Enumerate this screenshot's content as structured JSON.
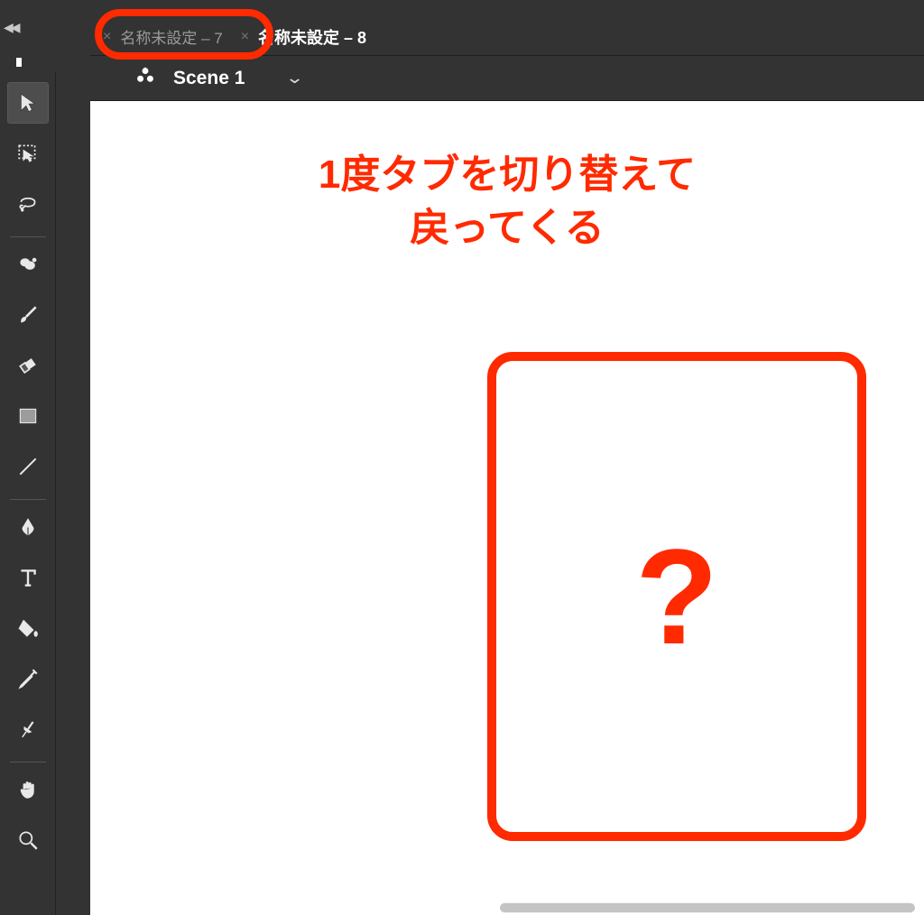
{
  "tabs": [
    {
      "label": "名称未設定 – 7",
      "active": false
    },
    {
      "label": "名称未設定 – 8",
      "active": true
    }
  ],
  "scene": {
    "label": "Scene 1"
  },
  "annotation": {
    "line1": "1度タブを切り替えて",
    "line2": "戻ってくる",
    "card_symbol": "?"
  },
  "tools": [
    {
      "id": "selection-tool",
      "selected": true
    },
    {
      "id": "free-transform-tool",
      "selected": false
    },
    {
      "id": "lasso-tool",
      "selected": false
    },
    {
      "sep": true
    },
    {
      "id": "brush-blob-tool",
      "selected": false
    },
    {
      "id": "brush-tool",
      "selected": false
    },
    {
      "id": "eraser-tool",
      "selected": false
    },
    {
      "id": "rectangle-tool",
      "selected": false
    },
    {
      "id": "line-tool",
      "selected": false
    },
    {
      "sep": true
    },
    {
      "id": "pen-tool",
      "selected": false
    },
    {
      "id": "text-tool",
      "selected": false
    },
    {
      "id": "paint-bucket-tool",
      "selected": false
    },
    {
      "id": "eyedropper-tool",
      "selected": false
    },
    {
      "id": "pin-tool",
      "selected": false
    },
    {
      "sep": true
    },
    {
      "id": "hand-tool",
      "selected": false
    },
    {
      "id": "zoom-tool",
      "selected": false
    }
  ]
}
